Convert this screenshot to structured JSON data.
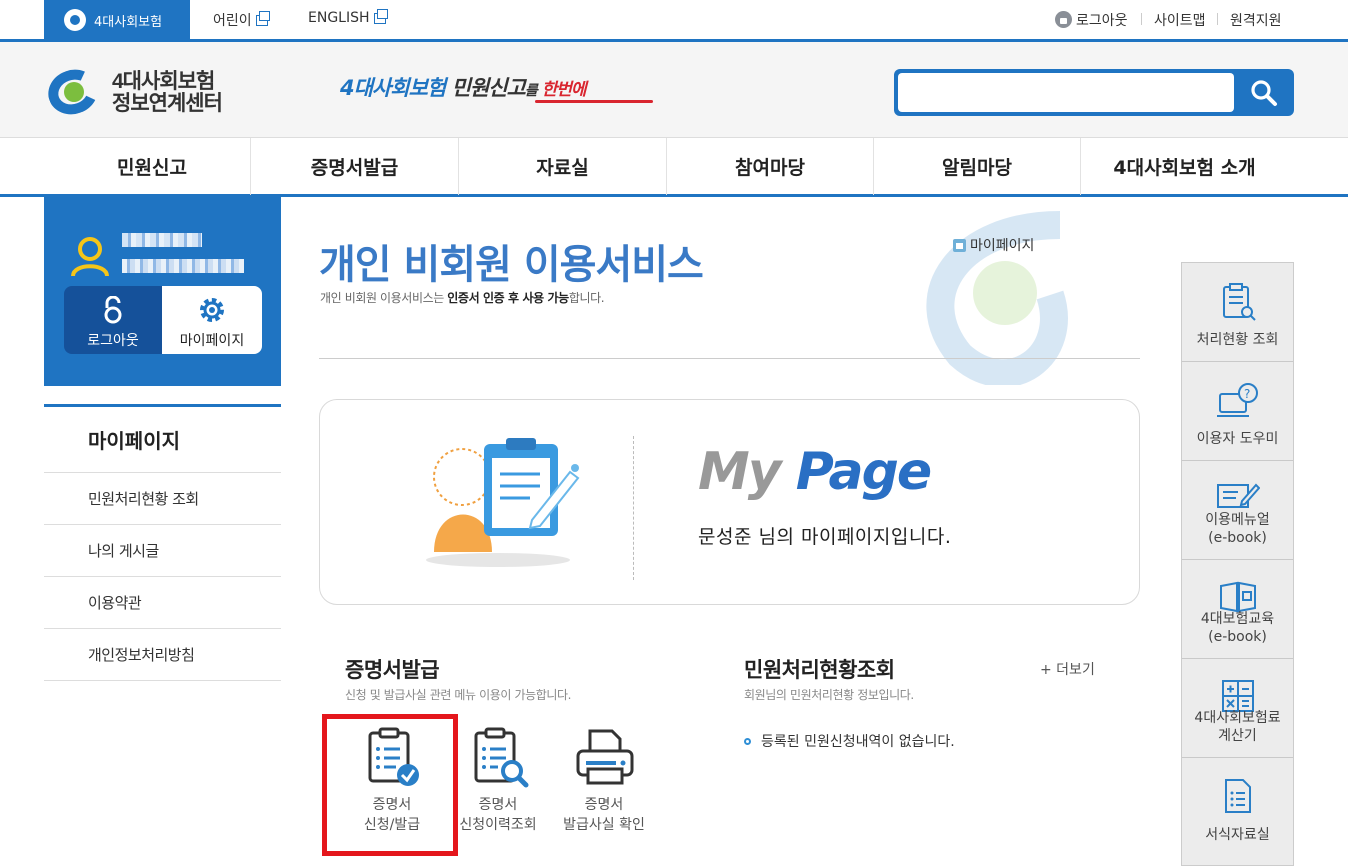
{
  "topbar": {
    "brand_tab": "4대사회보험",
    "links": [
      "어린이",
      "ENGLISH"
    ],
    "utility": {
      "logout": "로그아웃",
      "sitemap": "사이트맵",
      "remote": "원격지원"
    }
  },
  "header": {
    "logo_line1": "4대사회보험",
    "logo_line2": "정보연계센터",
    "slogan": {
      "part1": "4대사회보험",
      "part2": " 민원신고",
      "part3": "를",
      "part4": " 한번에"
    },
    "search": {
      "placeholder": "",
      "value": ""
    }
  },
  "gnb": [
    "민원신고",
    "증명서발급",
    "자료실",
    "참여마당",
    "알림마당",
    "4대사회보험 소개"
  ],
  "profile": {
    "logout_label": "로그아웃",
    "mypage_label": "마이페이지"
  },
  "leftnav": {
    "title": "마이페이지",
    "items": [
      "민원처리현황 조회",
      "나의 게시글",
      "이용약관",
      "개인정보처리방침"
    ]
  },
  "main": {
    "title": "개인 비회원 이용서비스",
    "subtitle_pre": "개인 비회원 이용서비스는 ",
    "subtitle_bold": "인증서 인증 후 사용 가능",
    "subtitle_post": "합니다.",
    "breadcrumb": "마이페이지",
    "card": {
      "logo_my": "My",
      "logo_page": "Page",
      "greeting": "문성준 님의 마이페이지입니다."
    },
    "cert": {
      "title": "증명서발급",
      "subtitle": "신청 및 발급사실 관련 메뉴 이용이 가능합니다.",
      "services": [
        {
          "line1": "증명서",
          "line2": "신청/발급"
        },
        {
          "line1": "증명서",
          "line2": "신청이력조회"
        },
        {
          "line1": "증명서",
          "line2": "발급사실 확인"
        }
      ]
    },
    "status": {
      "title": "민원처리현황조회",
      "subtitle": "회원님의 민원처리현황 정보입니다.",
      "more": "+ 더보기",
      "empty": "등록된 민원신청내역이 없습니다."
    }
  },
  "quick_menu": [
    {
      "line1": "처리현황 조회",
      "line2": ""
    },
    {
      "line1": "이용자 도우미",
      "line2": ""
    },
    {
      "line1": "이용메뉴얼",
      "line2": "(e-book)"
    },
    {
      "line1": "4대보험교육",
      "line2": "(e-book)"
    },
    {
      "line1": "4대사회보험료",
      "line2": "계산기"
    },
    {
      "line1": "서식자료실",
      "line2": ""
    }
  ],
  "colors": {
    "brand_blue": "#1f74c2",
    "highlight_red": "#e4161c",
    "title_blue": "#3a7ac6"
  }
}
